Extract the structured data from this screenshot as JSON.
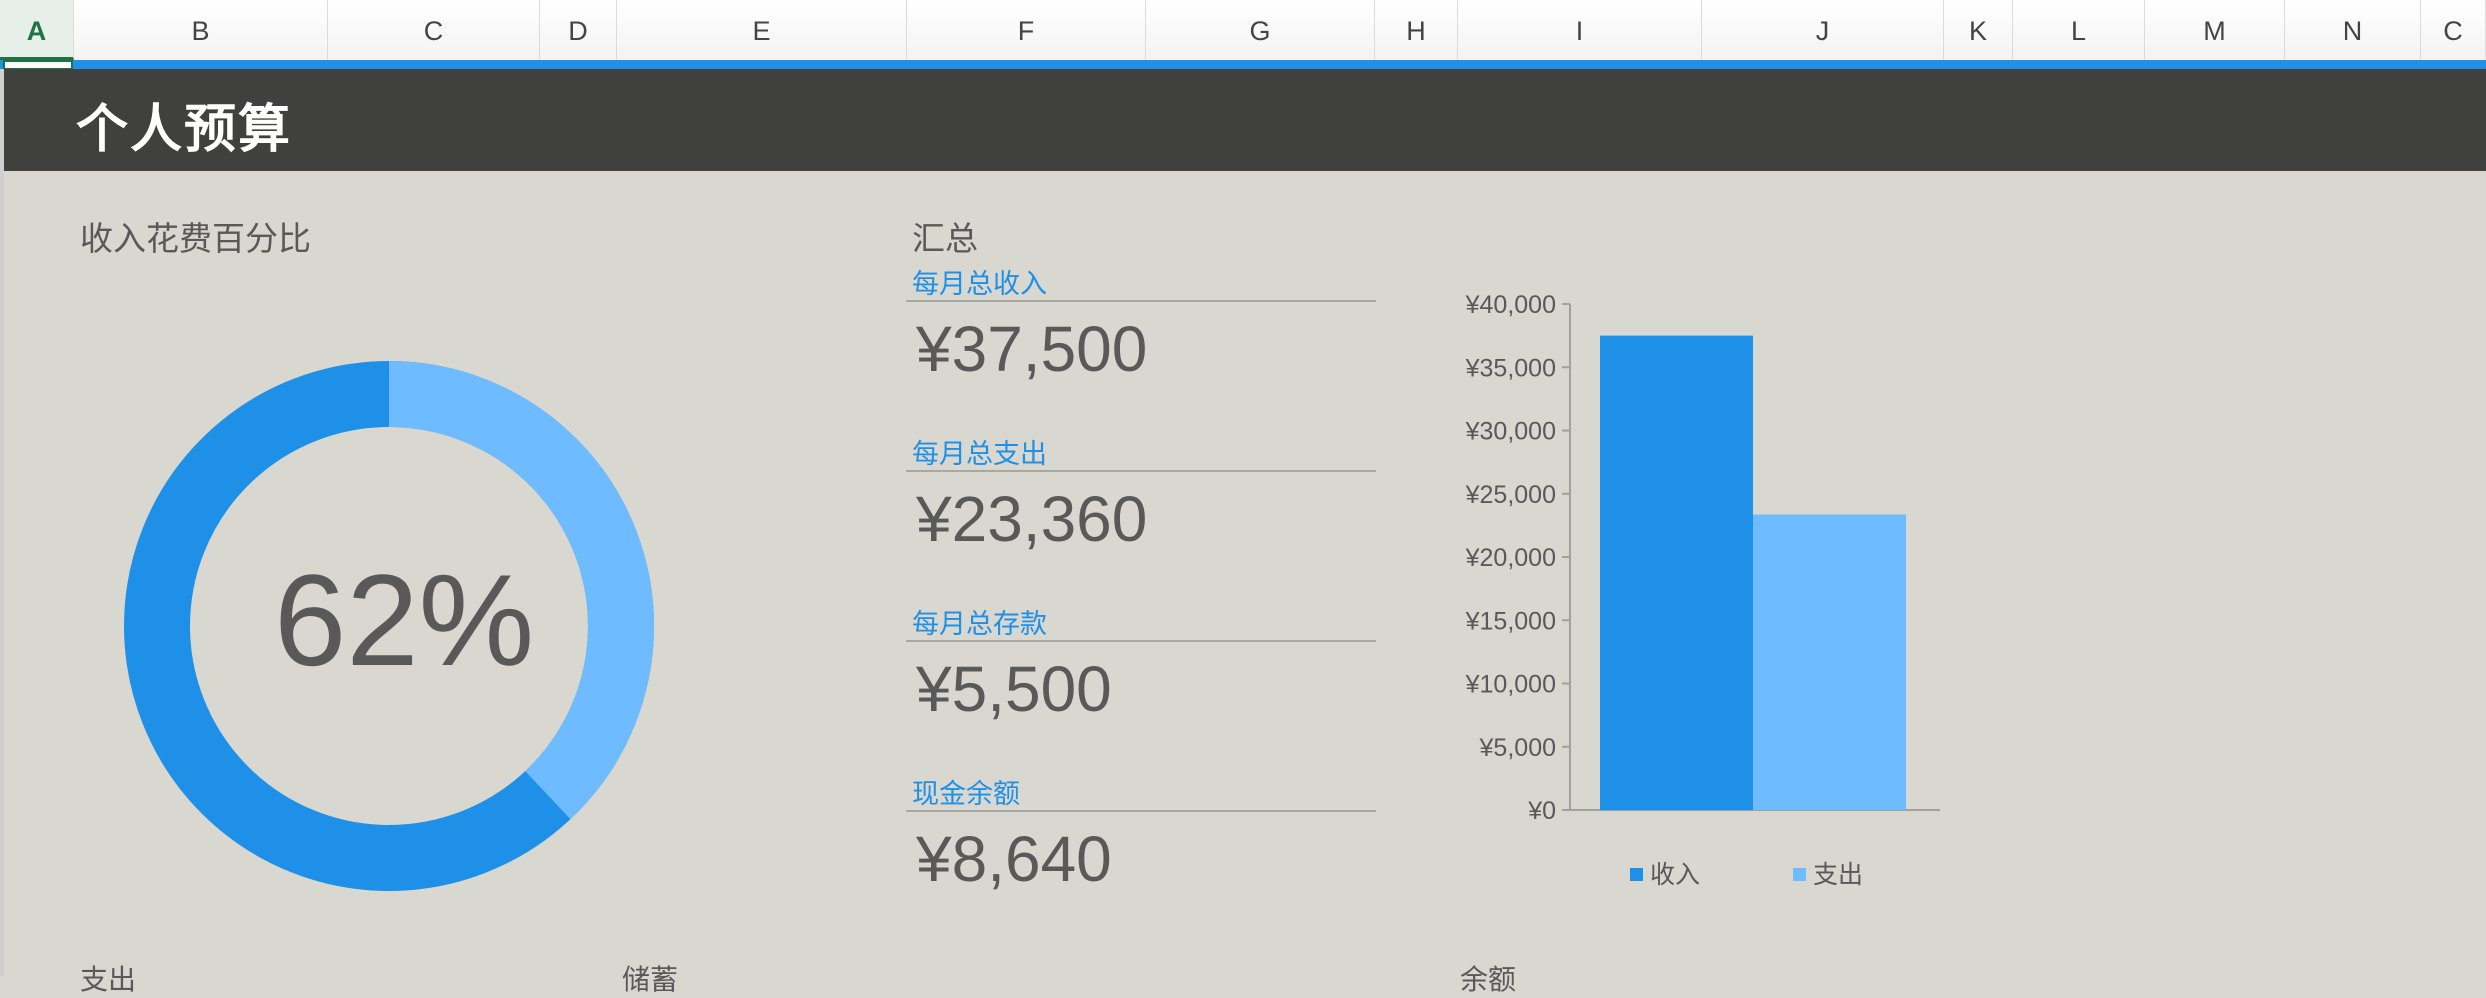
{
  "columns": [
    "A",
    "B",
    "C",
    "D",
    "E",
    "F",
    "G",
    "H",
    "I",
    "J",
    "K",
    "L",
    "M",
    "N",
    "C"
  ],
  "sheet": {
    "title": "个人预算",
    "percent_section": {
      "title": "收入花费百分比",
      "value": "62%",
      "spent_fraction": 0.62
    },
    "summary": {
      "title": "汇总",
      "items": [
        {
          "label": "每月总收入",
          "value": "¥37,500"
        },
        {
          "label": "每月总支出",
          "value": "¥23,360"
        },
        {
          "label": "每月总存款",
          "value": "¥5,500"
        },
        {
          "label": "现金余额",
          "value": "¥8,640"
        }
      ]
    },
    "bottom_cut": [
      "支出",
      "储蓄",
      "余额"
    ]
  },
  "colors": {
    "accent": "#1e90e8",
    "light": "#6ebcff",
    "title_bar": "#40403e",
    "sheet_bg": "#d8d7d0"
  },
  "chart_data": {
    "type": "bar",
    "categories": [
      "收入",
      "支出"
    ],
    "series": [
      {
        "name": "收入",
        "values": [
          37500
        ]
      },
      {
        "name": "支出",
        "values": [
          23360
        ]
      }
    ],
    "ylim": [
      0,
      40000
    ],
    "yticks": [
      "¥0",
      "¥5,000",
      "¥10,000",
      "¥15,000",
      "¥20,000",
      "¥25,000",
      "¥30,000",
      "¥35,000",
      "¥40,000"
    ],
    "legend": "bottom"
  }
}
